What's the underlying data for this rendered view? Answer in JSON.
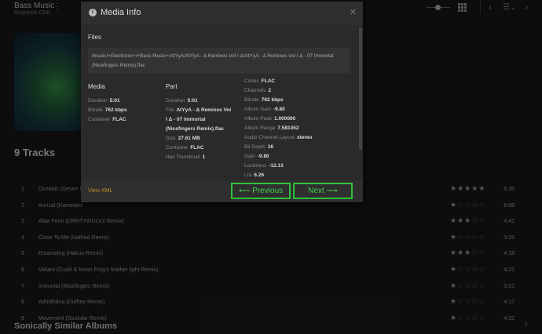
{
  "library": {
    "title": "Bass Music",
    "subtitle": "Requests.Club"
  },
  "tracks_heading": "9 Tracks",
  "tracks": [
    {
      "n": "1",
      "title": "Oceanic (Desert D",
      "duration": "6:36",
      "rating": 5
    },
    {
      "n": "2",
      "title": "Aurical (Kaminanc",
      "duration": "8:08",
      "rating": 1
    },
    {
      "n": "3",
      "title": "Altar Form (DRRTYWULVZ Remix)",
      "duration": "4:41",
      "rating": 3
    },
    {
      "n": "4",
      "title": "Close To Me (Halfred Remix)",
      "duration": "3:26",
      "rating": 1
    },
    {
      "n": "5",
      "title": "Emanating (Hakuu Remix)",
      "duration": "4:18",
      "rating": 3
    },
    {
      "n": "6",
      "title": "Valiant (Cualli & Moon Frog's feather light Remix)",
      "duration": "4:21",
      "rating": 1
    },
    {
      "n": "7",
      "title": "Immortal (Nicefingers Remix)",
      "duration": "5:01",
      "rating": 1
    },
    {
      "n": "8",
      "title": "Adhiṭṭhāna (Duffrey Remix)",
      "duration": "4:17",
      "rating": 1
    },
    {
      "n": "9",
      "title": "Movement (Soulular Remix)",
      "duration": "4:22",
      "rating": 1
    }
  ],
  "similar_heading": "Sonically Similar Albums",
  "modal": {
    "title": "Media Info",
    "files_heading": "Files",
    "path": "/music/+Electronic+/+Bass Music+/AtYyA/AtYyA - Δ Remixes Vol I Δ/AtYyA - Δ Remixes Vol I Δ - 07 Immortal (Nicefingers Remix).flac",
    "media": {
      "heading": "Media",
      "items": [
        {
          "k": "Duration",
          "v": "5:01"
        },
        {
          "k": "Bitrate",
          "v": "762 kbps"
        },
        {
          "k": "Container",
          "v": "FLAC"
        }
      ]
    },
    "part": {
      "heading": "Part",
      "items": [
        {
          "k": "Duration",
          "v": "5:01"
        },
        {
          "k": "File",
          "v": "AtYyA - Δ Remixes Vol"
        },
        {
          "k": "",
          "v": "I Δ - 07 Immortal"
        },
        {
          "k": "",
          "v": "(Nicefingers Remix).flac"
        },
        {
          "k": "Size",
          "v": "27.61 MB"
        },
        {
          "k": "Container",
          "v": "FLAC"
        },
        {
          "k": "Has Thumbnail",
          "v": "1"
        }
      ]
    },
    "stream": {
      "items": [
        {
          "k": "Codec",
          "v": "FLAC"
        },
        {
          "k": "Channels",
          "v": "2"
        },
        {
          "k": "Bitrate",
          "v": "762 kbps"
        },
        {
          "k": "Album Gain",
          "v": "-9.80"
        },
        {
          "k": "Album Peak",
          "v": "1.000000"
        },
        {
          "k": "Album Range",
          "v": "7.581452"
        },
        {
          "k": "Audio Channel Layout",
          "v": "stereo"
        },
        {
          "k": "Bit Depth",
          "v": "16"
        },
        {
          "k": "Gain",
          "v": "-9.80"
        },
        {
          "k": "Loudness",
          "v": "-12.13"
        },
        {
          "k": "Lra",
          "v": "6.26"
        }
      ]
    },
    "view_xml": "View XML",
    "previous": "Previous",
    "next": "Next",
    "prev_arrow": "⟵",
    "next_arrow": "⟶"
  }
}
